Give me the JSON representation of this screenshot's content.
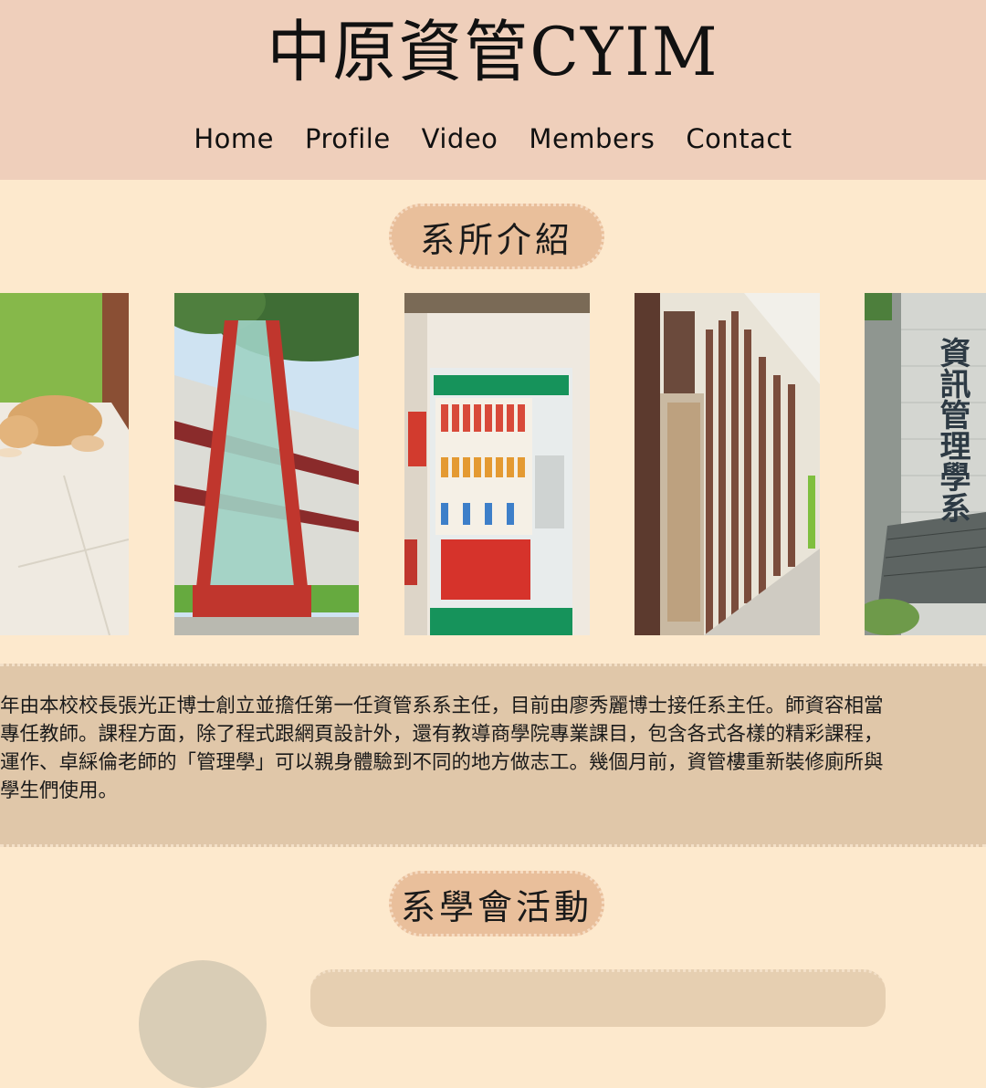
{
  "header": {
    "title": "中原資管CYIM",
    "nav": [
      "Home",
      "Profile",
      "Video",
      "Members",
      "Contact"
    ]
  },
  "sections": {
    "intro_heading": "系所介紹",
    "activities_heading": "系學會活動"
  },
  "intro": {
    "lines": [
      "年由本校校長張光正博士創立並擔任第一任資管系系主任，目前由廖秀麗博士接任系主任。師資容相當",
      "專任教師。課程方面，除了程式跟網頁設計外，還有教導商學院專業課目，包含各式各樣的精彩課程，",
      "運作、卓綵倫老師的「管理學」可以親身體驗到不同的地方做志工。幾個月前，資管樓重新裝修廁所與",
      "學生們使用。"
    ]
  },
  "gallery": {
    "photos": [
      "dog-photo",
      "elevator-tower-photo",
      "vending-machine-photo",
      "hallway-elevator-photo",
      "building-sign-photo"
    ],
    "building_sign_text": "資訊管理學系"
  }
}
